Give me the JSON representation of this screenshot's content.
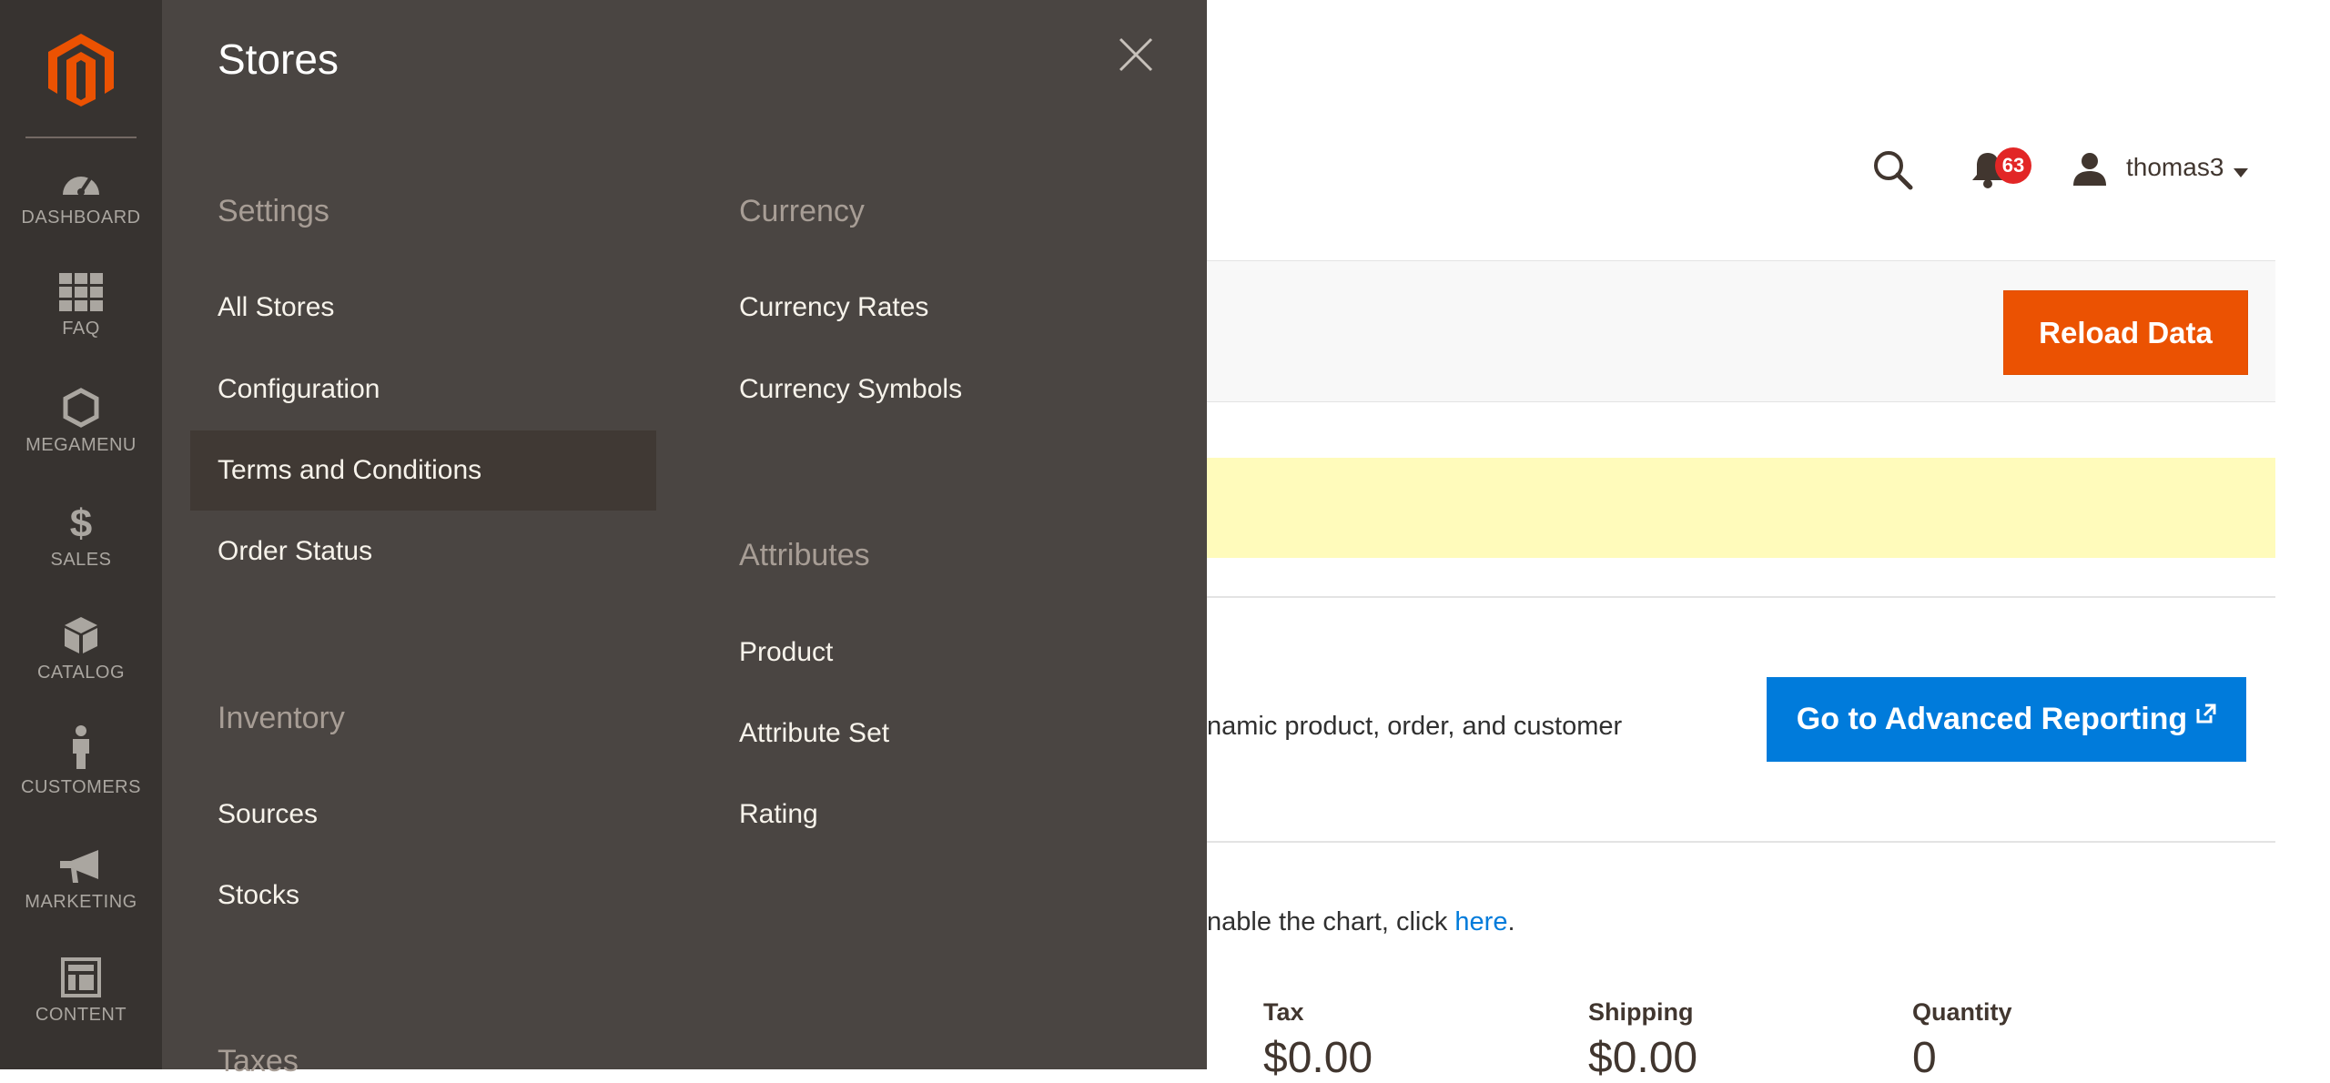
{
  "brand": {
    "logo_color": "#eb5202"
  },
  "sidebar": {
    "items": [
      {
        "label": "DASHBOARD",
        "icon": "dashboard-icon"
      },
      {
        "label": "FAQ",
        "icon": "grid-icon"
      },
      {
        "label": "MEGAMENU",
        "icon": "hexagon-icon"
      },
      {
        "label": "SALES",
        "icon": "dollar-icon"
      },
      {
        "label": "CATALOG",
        "icon": "box-icon"
      },
      {
        "label": "CUSTOMERS",
        "icon": "person-icon"
      },
      {
        "label": "MARKETING",
        "icon": "megaphone-icon"
      },
      {
        "label": "CONTENT",
        "icon": "layout-icon"
      }
    ]
  },
  "flyout": {
    "title": "Stores",
    "groups": {
      "settings": {
        "title": "Settings",
        "items": [
          "All Stores",
          "Configuration",
          "Terms and Conditions",
          "Order Status"
        ]
      },
      "inventory": {
        "title": "Inventory",
        "items": [
          "Sources",
          "Stocks"
        ]
      },
      "taxes": {
        "title": "Taxes"
      },
      "currency": {
        "title": "Currency",
        "items": [
          "Currency Rates",
          "Currency Symbols"
        ]
      },
      "attributes": {
        "title": "Attributes",
        "items": [
          "Product",
          "Attribute Set",
          "Rating"
        ]
      }
    }
  },
  "header": {
    "notifications_count": "63",
    "user_name": "thomas3"
  },
  "actions": {
    "reload_label": "Reload Data"
  },
  "advanced_reporting": {
    "text": "namic product, order, and customer",
    "button_label": "Go to Advanced Reporting"
  },
  "chart_notice": {
    "text": "nable the chart, click ",
    "link": "here",
    "end": "."
  },
  "totals": [
    {
      "label": "Tax",
      "value": "$0.00"
    },
    {
      "label": "Shipping",
      "value": "$0.00"
    },
    {
      "label": "Quantity",
      "value": "0"
    }
  ],
  "colors": {
    "sidebar_bg": "#373330",
    "flyout_bg": "#4a4542",
    "accent_orange": "#eb5202",
    "link_blue": "#007bdb",
    "notice_yellow": "#fffbbb"
  }
}
